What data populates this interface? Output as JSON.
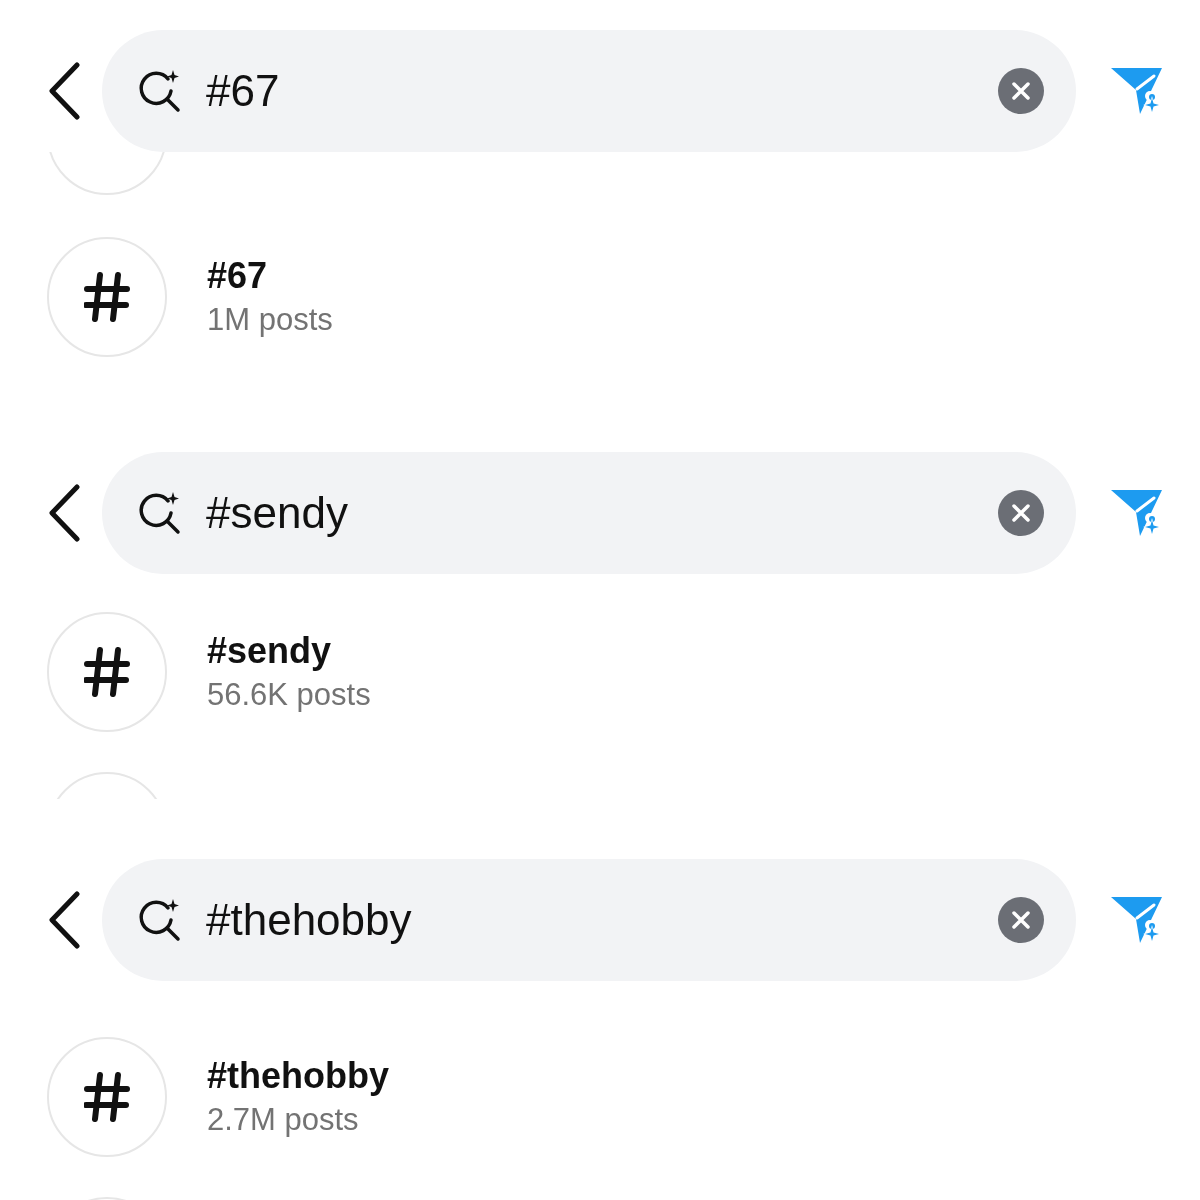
{
  "panels": [
    {
      "query": "#67",
      "result": {
        "tag": "#67",
        "count": "1M posts"
      },
      "more_above": true,
      "more_below": false
    },
    {
      "query": "#sendy",
      "result": {
        "tag": "#sendy",
        "count": "56.6K posts"
      },
      "more_above": false,
      "more_below": true
    },
    {
      "query": "#thehobby",
      "result": {
        "tag": "#thehobby",
        "count": "2.7M posts"
      },
      "more_above": false,
      "more_below": true
    }
  ]
}
